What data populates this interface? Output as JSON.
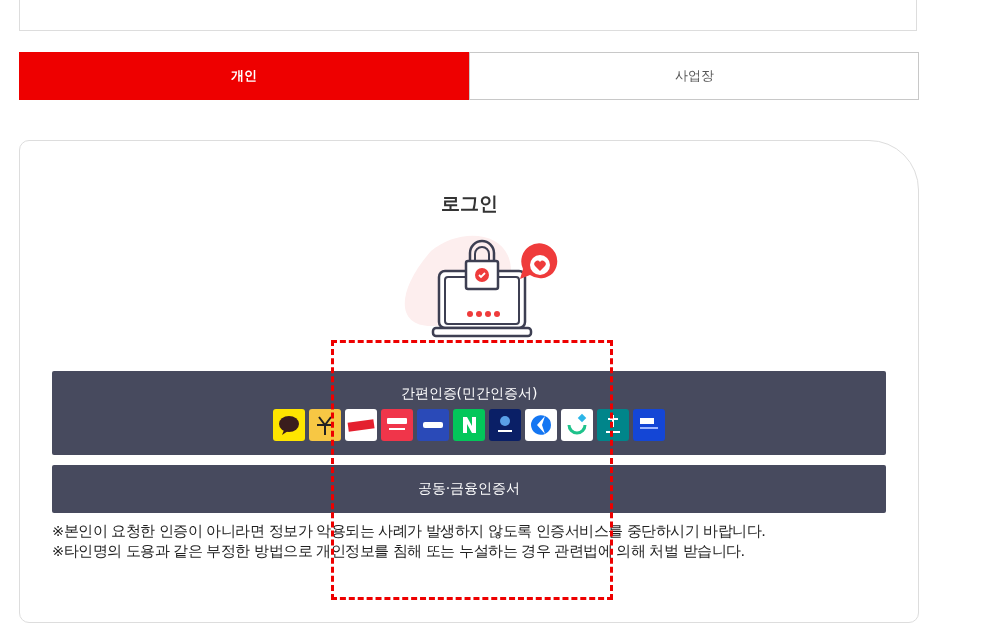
{
  "tabs": [
    {
      "label": "개인",
      "selected": true
    },
    {
      "label": "사업장",
      "selected": false
    }
  ],
  "login": {
    "title": "로그인",
    "buttons": [
      {
        "label": "간편인증(민간인증서)",
        "kind": "providers",
        "providers": [
          {
            "color": "#fee500"
          },
          {
            "color": "#f7c744"
          },
          {
            "color": "#ffffff"
          },
          {
            "color": "#f0354a"
          },
          {
            "color": "#2a4ab8"
          },
          {
            "color": "#03c75a"
          },
          {
            "color": "#0a1f66"
          },
          {
            "color": "#ffffff"
          },
          {
            "color": "#ffffff"
          },
          {
            "color": "#00858a"
          },
          {
            "color": "#1446d6"
          }
        ]
      },
      {
        "label": "공동·금융인증서",
        "kind": "plain"
      }
    ],
    "notes": [
      "※본인이 요청한 인증이 아니라면 정보가 악용되는 사례가 발생하지 않도록 인증서비스를 중단하시기 바랍니다.",
      "※타인명의 도용과 같은 부정한 방법으로 개인정보를 침해 또는 누설하는 경우 관련법에 의해 처벌 받습니다."
    ]
  }
}
